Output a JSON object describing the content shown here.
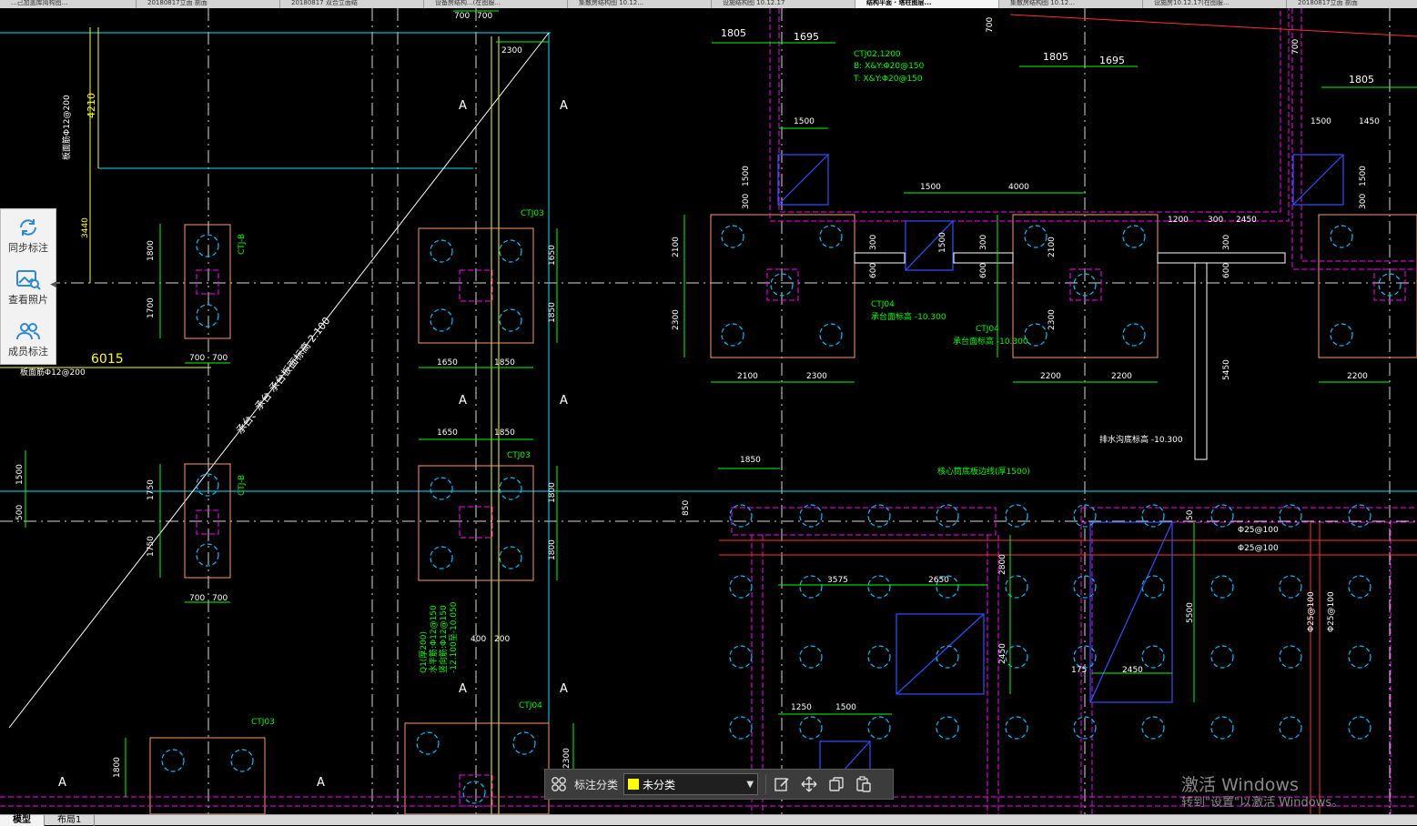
{
  "tabs": [
    "...己加盖库简构图...",
    "20180817立面 剖面",
    "20180817 双合立面结",
    "设备房结构...(在图服...",
    "集散房结构图 10.12...",
    "设施结构图 10.12.17",
    "结构平面 · 塔柱图层...",
    "集散房结构图 10.12...",
    "设施房10.12.17(在图服...",
    "20180817立面 剖面"
  ],
  "active_tab": 6,
  "side_panel": {
    "items": [
      {
        "label": "同步标注",
        "icon": "sync-icon"
      },
      {
        "label": "查看照片",
        "icon": "photo-icon"
      },
      {
        "label": "成员标注",
        "icon": "members-icon"
      }
    ]
  },
  "toolbar": {
    "label": "标注分类",
    "selected": "未分类",
    "swatch_color": "#ffff00",
    "icons": [
      "grid-icon",
      "edit-icon",
      "move-icon",
      "copy-icon",
      "paste-icon"
    ]
  },
  "watermark": {
    "title": "激活 Windows",
    "subtitle": "转到\"设置\"以激活 Windows。"
  },
  "bottom_tabs": [
    "模型",
    "布局1"
  ],
  "colors": {
    "dimension": "#00ff00",
    "outline": "#ff00ff",
    "pile": "#00bfff",
    "grid": "#ffffff",
    "section_line": "#ffff00",
    "rebar": "#ff3030",
    "footing": "#ff9966"
  },
  "drawing": {
    "section_mark": "A",
    "caps_left": [
      "CTJ-B",
      "CTJ-B",
      "CTJ03",
      "CTJ03",
      "CTJ03",
      "CTJ04"
    ],
    "caps_right": [
      "CTJ04",
      "CTJ04"
    ],
    "footing_note_1": "承台面标高 -10.300",
    "footing_note_2": "承台面标高 -10.300",
    "diag_note": "承台、承台 承台板面标高 2.100",
    "drain_note": "排水沟底标高 -10.300",
    "core_note": "核心筒底板边线(厚1500)",
    "rebar_1": "Φ25@100",
    "rebar_2": "Φ25@100",
    "rebar_3": "Φ25@100",
    "rebar_4": "Φ25@100",
    "top_spec": [
      "CTJ02,1200",
      "B: X&Y:Φ20@150",
      "T: X&Y:Φ20@150"
    ],
    "wall_spec": [
      "Q1(厚200)",
      "水平筋:Φ12@150",
      "竖向筋:Φ12@150",
      "-12.100至-10.050"
    ],
    "left_spec_1": "板面筋Φ12@200",
    "left_spec_2": "板面筋Φ12@200",
    "dims": {
      "d1805": "1805",
      "d1695": "1695",
      "d700": "700",
      "d2300": "2300",
      "d4210": "4210",
      "d3440": "3440",
      "d1800": "1800",
      "d1700": "1700",
      "d6015": "6015",
      "d1500": "1500",
      "d500": "500",
      "d1750": "1750",
      "d1650": "1650",
      "d1850": "1850",
      "d400": "400",
      "d200": "200",
      "d2100": "2100",
      "d4000": "4000",
      "d2200": "2200",
      "d1200": "1200",
      "d300": "300",
      "d2450": "2450",
      "d600": "600",
      "d5450": "5450",
      "d1450": "1450",
      "d850": "850",
      "d3575": "3575",
      "d2650": "2650",
      "d2800": "2800",
      "d5500": "5500",
      "d175": "175",
      "d1250": "1250",
      "d50": "50"
    }
  }
}
